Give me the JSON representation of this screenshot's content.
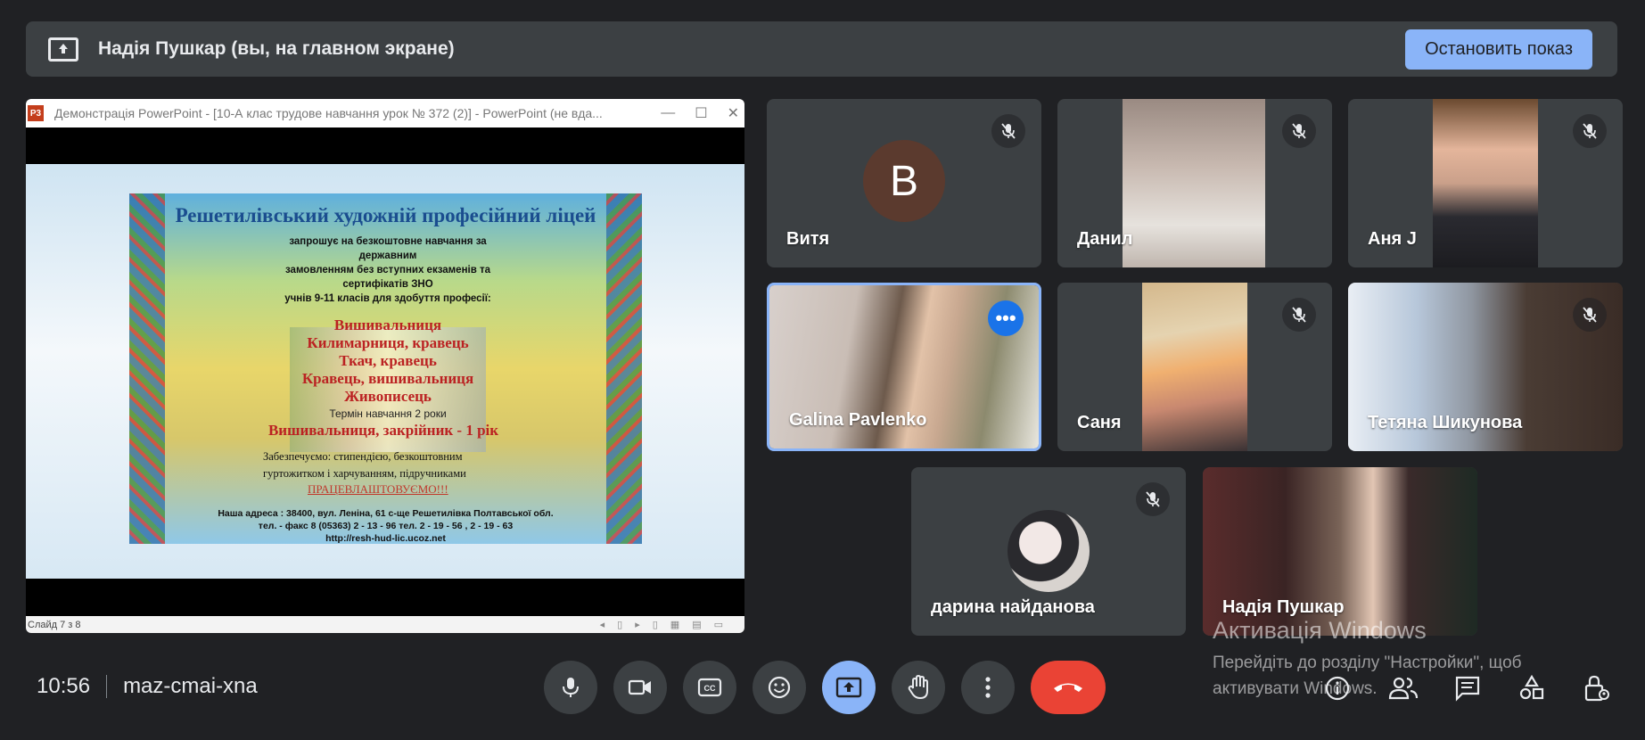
{
  "banner": {
    "title": "Надія Пушкар (вы, на главном экране)",
    "stop_label": "Остановить показ",
    "stop_color": "#8ab4f8"
  },
  "presentation": {
    "window_title": "Демонстрація PowerPoint - [10-А клас трудове навчання урок № 372 (2)] - PowerPoint (не вда...",
    "app_logo": "P3",
    "status": "Слайд 7 з 8",
    "slide": {
      "title": "Решетилівський художній професійний ліцей",
      "intro": [
        "запрошує на безкоштовне навчання за державним",
        "замовленням без вступних екзаменів та сертифікатів ЗНО",
        "учнів 9-11 класів для здобуття професії:"
      ],
      "professions": [
        "Вишивальниця",
        "Килимарниця, кравець",
        "Ткач, кравець",
        "Кравець, вишивальниця",
        "Живописець"
      ],
      "term": "Термін навчання 2 роки",
      "profession2": "Вишивальниця, закрійник - 1 рік",
      "provide": [
        "Забезпечуємо: стипендією, безкоштовним",
        "гуртожитком і харчуванням, підручниками"
      ],
      "employ": "ПРАЦЕВЛАШТОВУЄМО!!!",
      "address": [
        "Наша адреса : 38400, вул. Леніна, 61 с-ще Решетилівка Полтавської обл.",
        "тел. - факс 8 (05363) 2 - 13 - 96 тел. 2 - 19 - 56 , 2 - 19 - 63",
        "http://resh-hud-lic.ucoz.net"
      ]
    }
  },
  "participants": [
    {
      "name": "Витя",
      "avatar_letter": "B",
      "muted": true
    },
    {
      "name": "Данил",
      "muted": true
    },
    {
      "name": "Аня J",
      "muted": true
    },
    {
      "name": "Galina Pavlenko",
      "active_speaker": true
    },
    {
      "name": "Саня",
      "muted": true
    },
    {
      "name": "Тетяна Шикунова",
      "muted": true
    },
    {
      "name": "дарина найданова",
      "muted": true
    },
    {
      "name": "Надія Пушкар"
    }
  ],
  "bottom": {
    "time": "10:56",
    "meeting_code": "maz-cmai-xna"
  },
  "watermark": {
    "line1": "Активація Windows",
    "line2": "Перейдіть до розділу \"Настройки\", щоб",
    "line3": "активувати Windows."
  }
}
